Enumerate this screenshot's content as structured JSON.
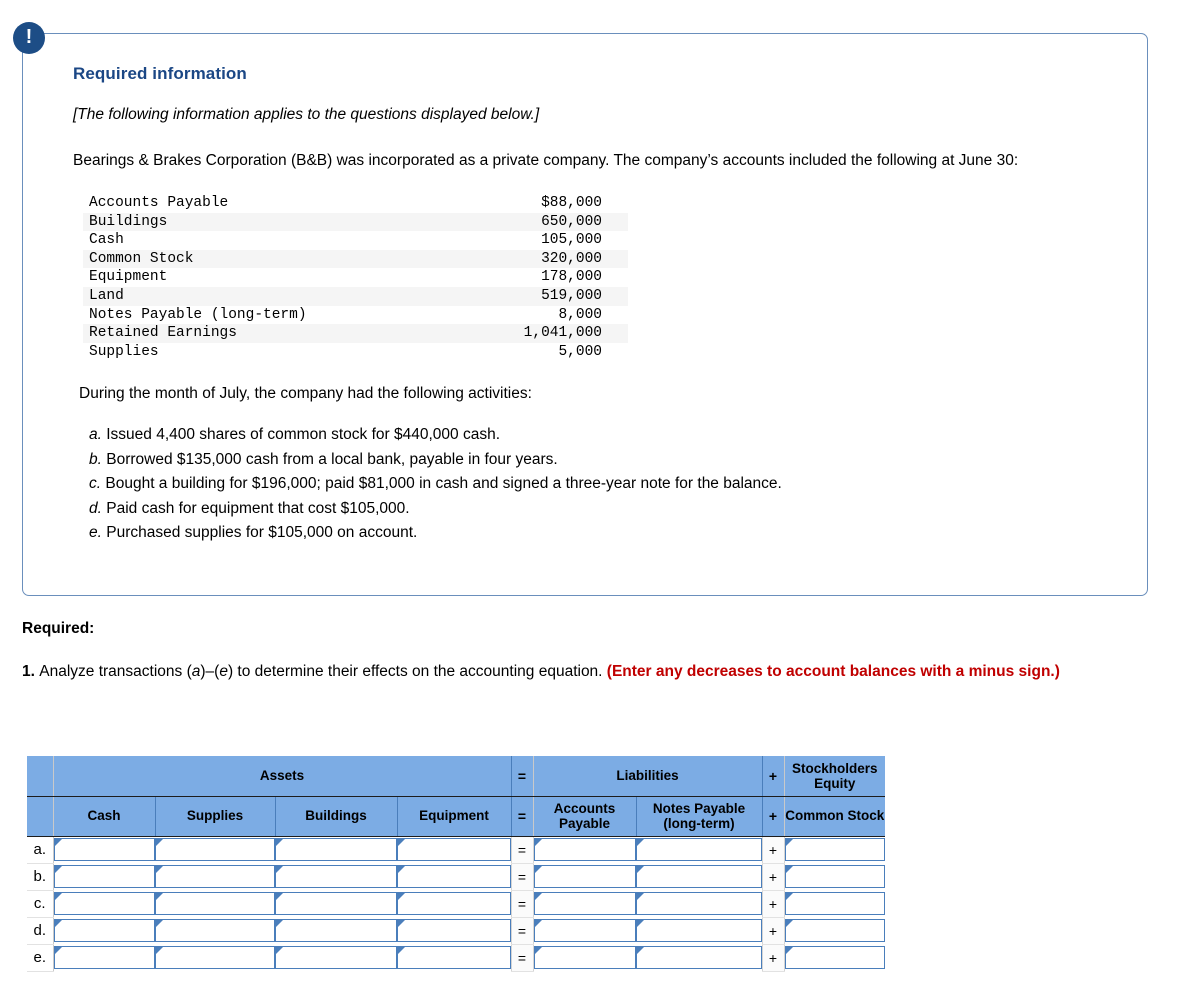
{
  "card": {
    "alert_icon": "exclamation-icon",
    "title": "Required information",
    "applies_note": "[The following information applies to the questions displayed below.]",
    "intro": "Bearings & Brakes Corporation (B&B) was incorporated as a private company. The company’s accounts included the following at June 30:",
    "accounts": [
      {
        "name": "Accounts Payable",
        "amount": "$88,000"
      },
      {
        "name": "Buildings",
        "amount": "650,000"
      },
      {
        "name": "Cash",
        "amount": "105,000"
      },
      {
        "name": "Common Stock",
        "amount": "320,000"
      },
      {
        "name": "Equipment",
        "amount": "178,000"
      },
      {
        "name": "Land",
        "amount": "519,000"
      },
      {
        "name": "Notes Payable (long-term)",
        "amount": "8,000"
      },
      {
        "name": "Retained Earnings",
        "amount": "1,041,000"
      },
      {
        "name": "Supplies",
        "amount": "5,000"
      }
    ],
    "activities_lead": "During the month of July, the company had the following activities:",
    "activities": [
      {
        "letter": "a.",
        "text": "Issued 4,400 shares of common stock for $440,000 cash."
      },
      {
        "letter": "b.",
        "text": "Borrowed $135,000 cash from a local bank, payable in four years."
      },
      {
        "letter": "c.",
        "text": "Bought a building for $196,000; paid $81,000 in cash and signed a three-year note for the balance."
      },
      {
        "letter": "d.",
        "text": "Paid cash for equipment that cost $105,000."
      },
      {
        "letter": "e.",
        "text": "Purchased supplies for $105,000 on account."
      }
    ]
  },
  "required": {
    "label": "Required:",
    "item_number": "1.",
    "item_text_before": "Analyze transactions (",
    "item_a": "a",
    "item_dash": ")–(",
    "item_e": "e",
    "item_text_after": ") to determine their effects on the accounting equation. ",
    "item_red": "(Enter any decreases to account balances with a minus sign.)"
  },
  "table": {
    "group_headers": {
      "assets": "Assets",
      "equals": "=",
      "liabilities": "Liabilities",
      "plus": "+",
      "stockholders_equity": "Stockholders Equity"
    },
    "column_headers": {
      "cash": "Cash",
      "supplies": "Supplies",
      "buildings": "Buildings",
      "equipment": "Equipment",
      "equals": "=",
      "accounts_payable": "Accounts Payable",
      "notes_payable": "Notes Payable (long-term)",
      "plus": "+",
      "common_stock": "Common Stock"
    },
    "rows": [
      {
        "label": "a.",
        "cash": "",
        "supplies": "",
        "buildings": "",
        "equipment": "",
        "eq": "=",
        "accounts_payable": "",
        "notes_payable": "",
        "plus": "+",
        "common_stock": ""
      },
      {
        "label": "b.",
        "cash": "",
        "supplies": "",
        "buildings": "",
        "equipment": "",
        "eq": "=",
        "accounts_payable": "",
        "notes_payable": "",
        "plus": "+",
        "common_stock": ""
      },
      {
        "label": "c.",
        "cash": "",
        "supplies": "",
        "buildings": "",
        "equipment": "",
        "eq": "=",
        "accounts_payable": "",
        "notes_payable": "",
        "plus": "+",
        "common_stock": ""
      },
      {
        "label": "d.",
        "cash": "",
        "supplies": "",
        "buildings": "",
        "equipment": "",
        "eq": "=",
        "accounts_payable": "",
        "notes_payable": "",
        "plus": "+",
        "common_stock": ""
      },
      {
        "label": "e.",
        "cash": "",
        "supplies": "",
        "buildings": "",
        "equipment": "",
        "eq": "=",
        "accounts_payable": "",
        "notes_payable": "",
        "plus": "+",
        "common_stock": ""
      }
    ]
  },
  "colors": {
    "header_blue": "#7cace4",
    "title_blue": "#1b4785",
    "badge_blue": "#1d4d86",
    "alert_red": "#c00000",
    "input_border": "#4a7ebb",
    "card_border": "#6a8fbc"
  }
}
